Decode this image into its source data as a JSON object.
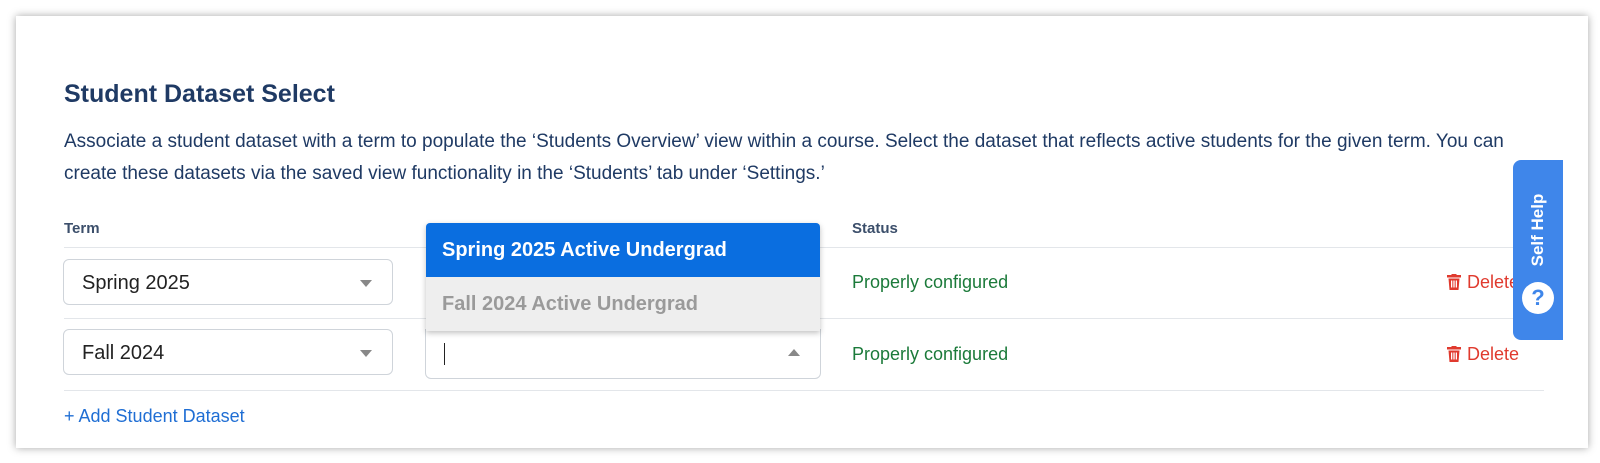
{
  "section": {
    "title": "Student Dataset Select",
    "description": "Associate a student dataset with a term to populate the ‘Students Overview’ view within a course. Select the dataset that reflects active students for the given term. You can create these datasets via the saved view functionality in the ‘Students’ tab under ‘Settings.’"
  },
  "table": {
    "headers": {
      "term": "Term",
      "status": "Status"
    },
    "rows": [
      {
        "term": "Spring 2025",
        "status": "Properly configured",
        "delete": "Delete"
      },
      {
        "term": "Fall 2024",
        "dataset": "",
        "status": "Properly configured",
        "delete": "Delete"
      }
    ]
  },
  "dropdown": {
    "options": [
      "Spring 2025 Active Undergrad",
      "Fall 2024 Active Undergrad"
    ],
    "highlighted": "Spring 2025 Active Undergrad"
  },
  "add_link": "+ Add Student Dataset",
  "help": {
    "label": "Self Help",
    "icon": "?"
  },
  "colors": {
    "accent": "#0a6ee0",
    "status_ok": "#1b7a3a",
    "danger": "#e03a2e",
    "title": "#1f3a64",
    "help_tab": "#3f86ea"
  },
  "icons": {
    "trash": "trash-icon",
    "caret": "chevron-down-icon",
    "help": "question-icon"
  }
}
